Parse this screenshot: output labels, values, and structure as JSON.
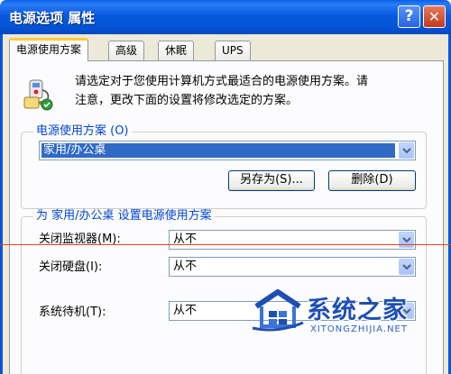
{
  "window": {
    "title": "电源选项 属性",
    "help_glyph": "?",
    "close_glyph": "✕"
  },
  "tabs": [
    {
      "label": "电源使用方案",
      "active": true
    },
    {
      "label": "高级",
      "active": false
    },
    {
      "label": "休眠",
      "active": false
    },
    {
      "label": "UPS",
      "active": false
    }
  ],
  "intro": {
    "icon": "power-scheme-icon",
    "line1": "请选定对于您使用计算机方式最适合的电源使用方案。请",
    "line2": "注意，更改下面的设置将修改选定的方案。"
  },
  "scheme_group": {
    "label": "电源使用方案 (O)",
    "selected": "家用/办公桌",
    "save_as_label": "另存为(S)...",
    "delete_label": "删除(D)"
  },
  "settings_group": {
    "label": "为 家用/办公桌 设置电源使用方案",
    "monitor_label": "关闭监视器(M):",
    "monitor_value": "从不",
    "hdd_label": "关闭硬盘(I):",
    "hdd_value": "从不",
    "standby_label": "系统待机(T):",
    "standby_value": "从不"
  },
  "watermark": {
    "cn": "系统之家",
    "en": "XITONGZHIJIA.NET"
  },
  "colors": {
    "title_bar": "#0a5ae0",
    "group_label": "#0046d5",
    "selection": "#316ac5",
    "active_tab_accent": "#ffc83c"
  }
}
